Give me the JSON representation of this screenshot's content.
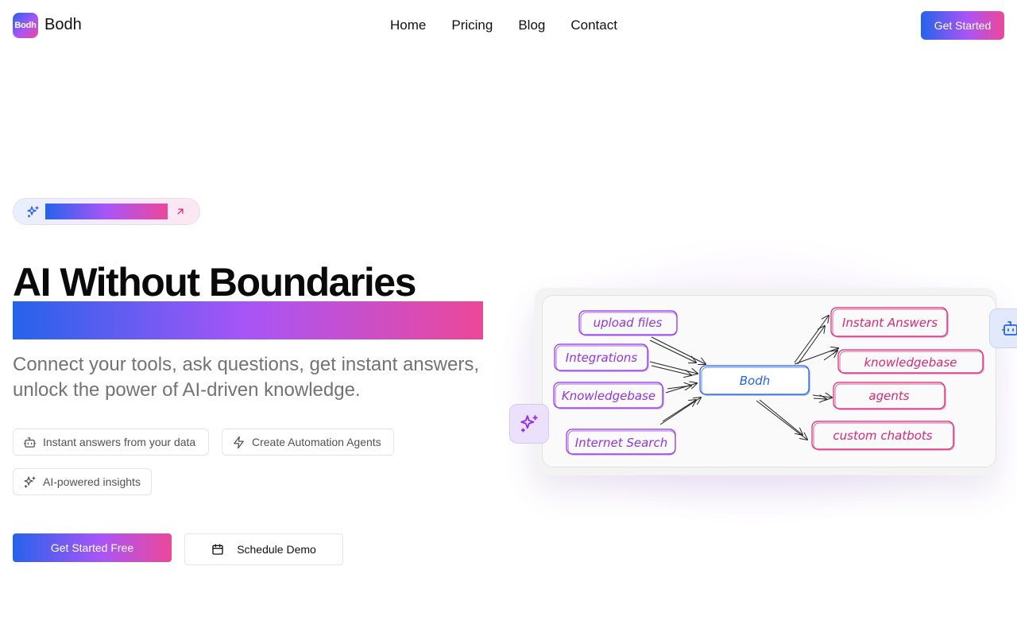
{
  "nav": {
    "logo_text": "Bodh",
    "brand": "Bodh",
    "links": [
      "Home",
      "Pricing",
      "Blog",
      "Contact"
    ],
    "cta": "Get Started"
  },
  "badge": {
    "icon": "sparkles-icon",
    "arrow_icon": "arrow-up-right-icon"
  },
  "hero": {
    "title": "AI Without Boundaries",
    "subtitle": "Connect your tools, ask questions, get instant answers, unlock the power of AI-driven knowledge.",
    "features": [
      {
        "icon": "bot-icon",
        "label": "Instant answers from your data"
      },
      {
        "icon": "zap-icon",
        "label": "Create Automation Agents"
      },
      {
        "icon": "sparkles-icon",
        "label": "AI-powered insights"
      }
    ],
    "primary_cta": "Get Started Free",
    "secondary_cta": "Schedule Demo",
    "secondary_icon": "calendar-icon"
  },
  "diagram": {
    "center": "Bodh",
    "inputs": [
      "upload files",
      "Integrations",
      "Knowledgebase",
      "Internet Search"
    ],
    "outputs": [
      "Instant Answers",
      "knowledgebase",
      "agents",
      "custom chatbots"
    ],
    "colors": {
      "input": "#9333ea",
      "output": "#db2777",
      "center": "#2563eb",
      "arrow": "#222222"
    }
  }
}
